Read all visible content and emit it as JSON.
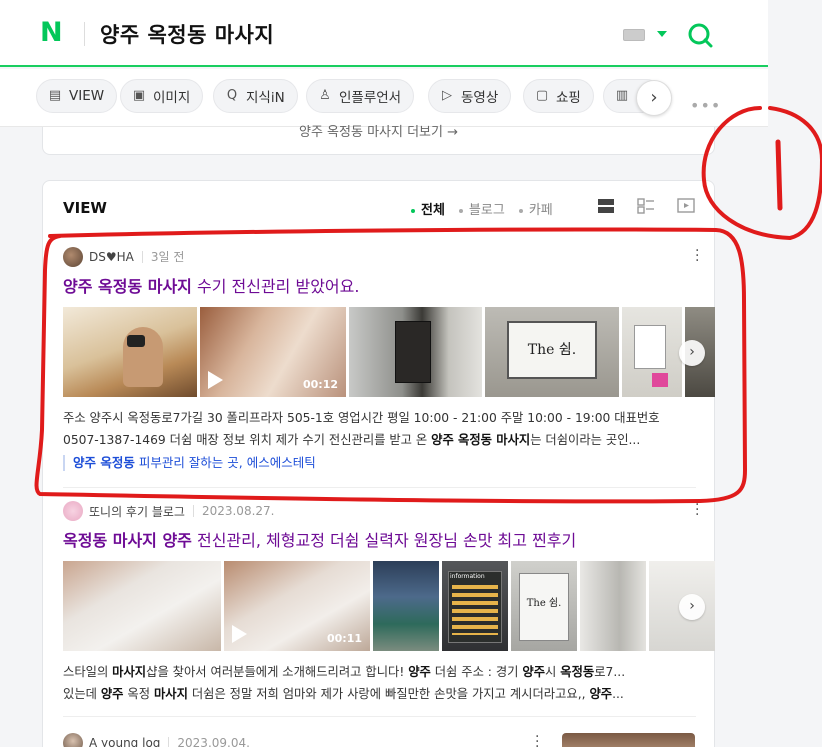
{
  "header": {
    "logo": "N",
    "query": "양주 옥정동 마사지"
  },
  "tabs": [
    {
      "label": "VIEW",
      "icon": "view-icon"
    },
    {
      "label": "이미지",
      "icon": "image-icon"
    },
    {
      "label": "지식iN",
      "icon": "knowledge-icon"
    },
    {
      "label": "인플루언서",
      "icon": "person-icon"
    },
    {
      "label": "동영상",
      "icon": "play-icon"
    },
    {
      "label": "쇼핑",
      "icon": "shopping-icon"
    },
    {
      "label": "",
      "icon": "news-icon"
    }
  ],
  "prev_more": "양주 옥정동 마사지 더보기 →",
  "view": {
    "title": "VIEW",
    "filters": [
      "전체",
      "블로그",
      "카페"
    ]
  },
  "posts": [
    {
      "author": "DS♥HA",
      "date": "3일 전",
      "title_bold": "양주 옥정동 마사지",
      "title_rest": " 수기 전신관리 받았어요.",
      "video_duration": "00:12",
      "desc1": "주소 양주시 옥정동로7가길 30 폴리프라자 505-1호 영업시간 평일 10:00 - 21:00 주말 10:00 - 19:00 대표번호",
      "desc2_a": "0507-1387-1469 더쉼 매장 정보 위치 제가 수기 전신관리를 받고 온 ",
      "desc2_b": "양주 옥정동 마사지",
      "desc2_c": "는 더쉼이라는 곳인...",
      "keyword_bold": "양주 옥정동",
      "keyword_rest": " 피부관리 잘하는 곳, 에스에스테틱"
    },
    {
      "author": "또니의 후기 블로그",
      "date": "2023.08.27.",
      "title_bold": "옥정동 마사지 양주",
      "title_rest": " 전신관리, 체형교정 더쉼 실력자 원장님 손맛 최고 찐후기",
      "video_duration": "00:11",
      "desc1_a": "스타일의 ",
      "desc1_b": "마사지",
      "desc1_c": "샵을 찾아서 여러분들에게 소개해드리려고 합니다! ",
      "desc1_d": "양주",
      "desc1_e": " 더쉼 주소 : 경기 ",
      "desc1_f": "양주",
      "desc1_g": "시 ",
      "desc1_h": "옥정동",
      "desc1_i": "로7...",
      "desc2_a": "있는데 ",
      "desc2_b": "양주",
      "desc2_c": " 옥정 ",
      "desc2_d": "마사지",
      "desc2_e": " 더쉼은 정말 저희 엄마와 제가 사랑에 빠질만한 손맛을 가지고 계시더라고요,, ",
      "desc2_f": "양주",
      "desc2_g": "..."
    },
    {
      "author": "A young log",
      "date": "2023.09.04."
    }
  ],
  "thumb_labels": {
    "sign": "The 쉼.",
    "sign2": "The 쉼.",
    "info": "information"
  },
  "colors": {
    "brand": "#03c75a",
    "visited_title": "#6e0b95",
    "annotation_red": "#e01b1b"
  }
}
